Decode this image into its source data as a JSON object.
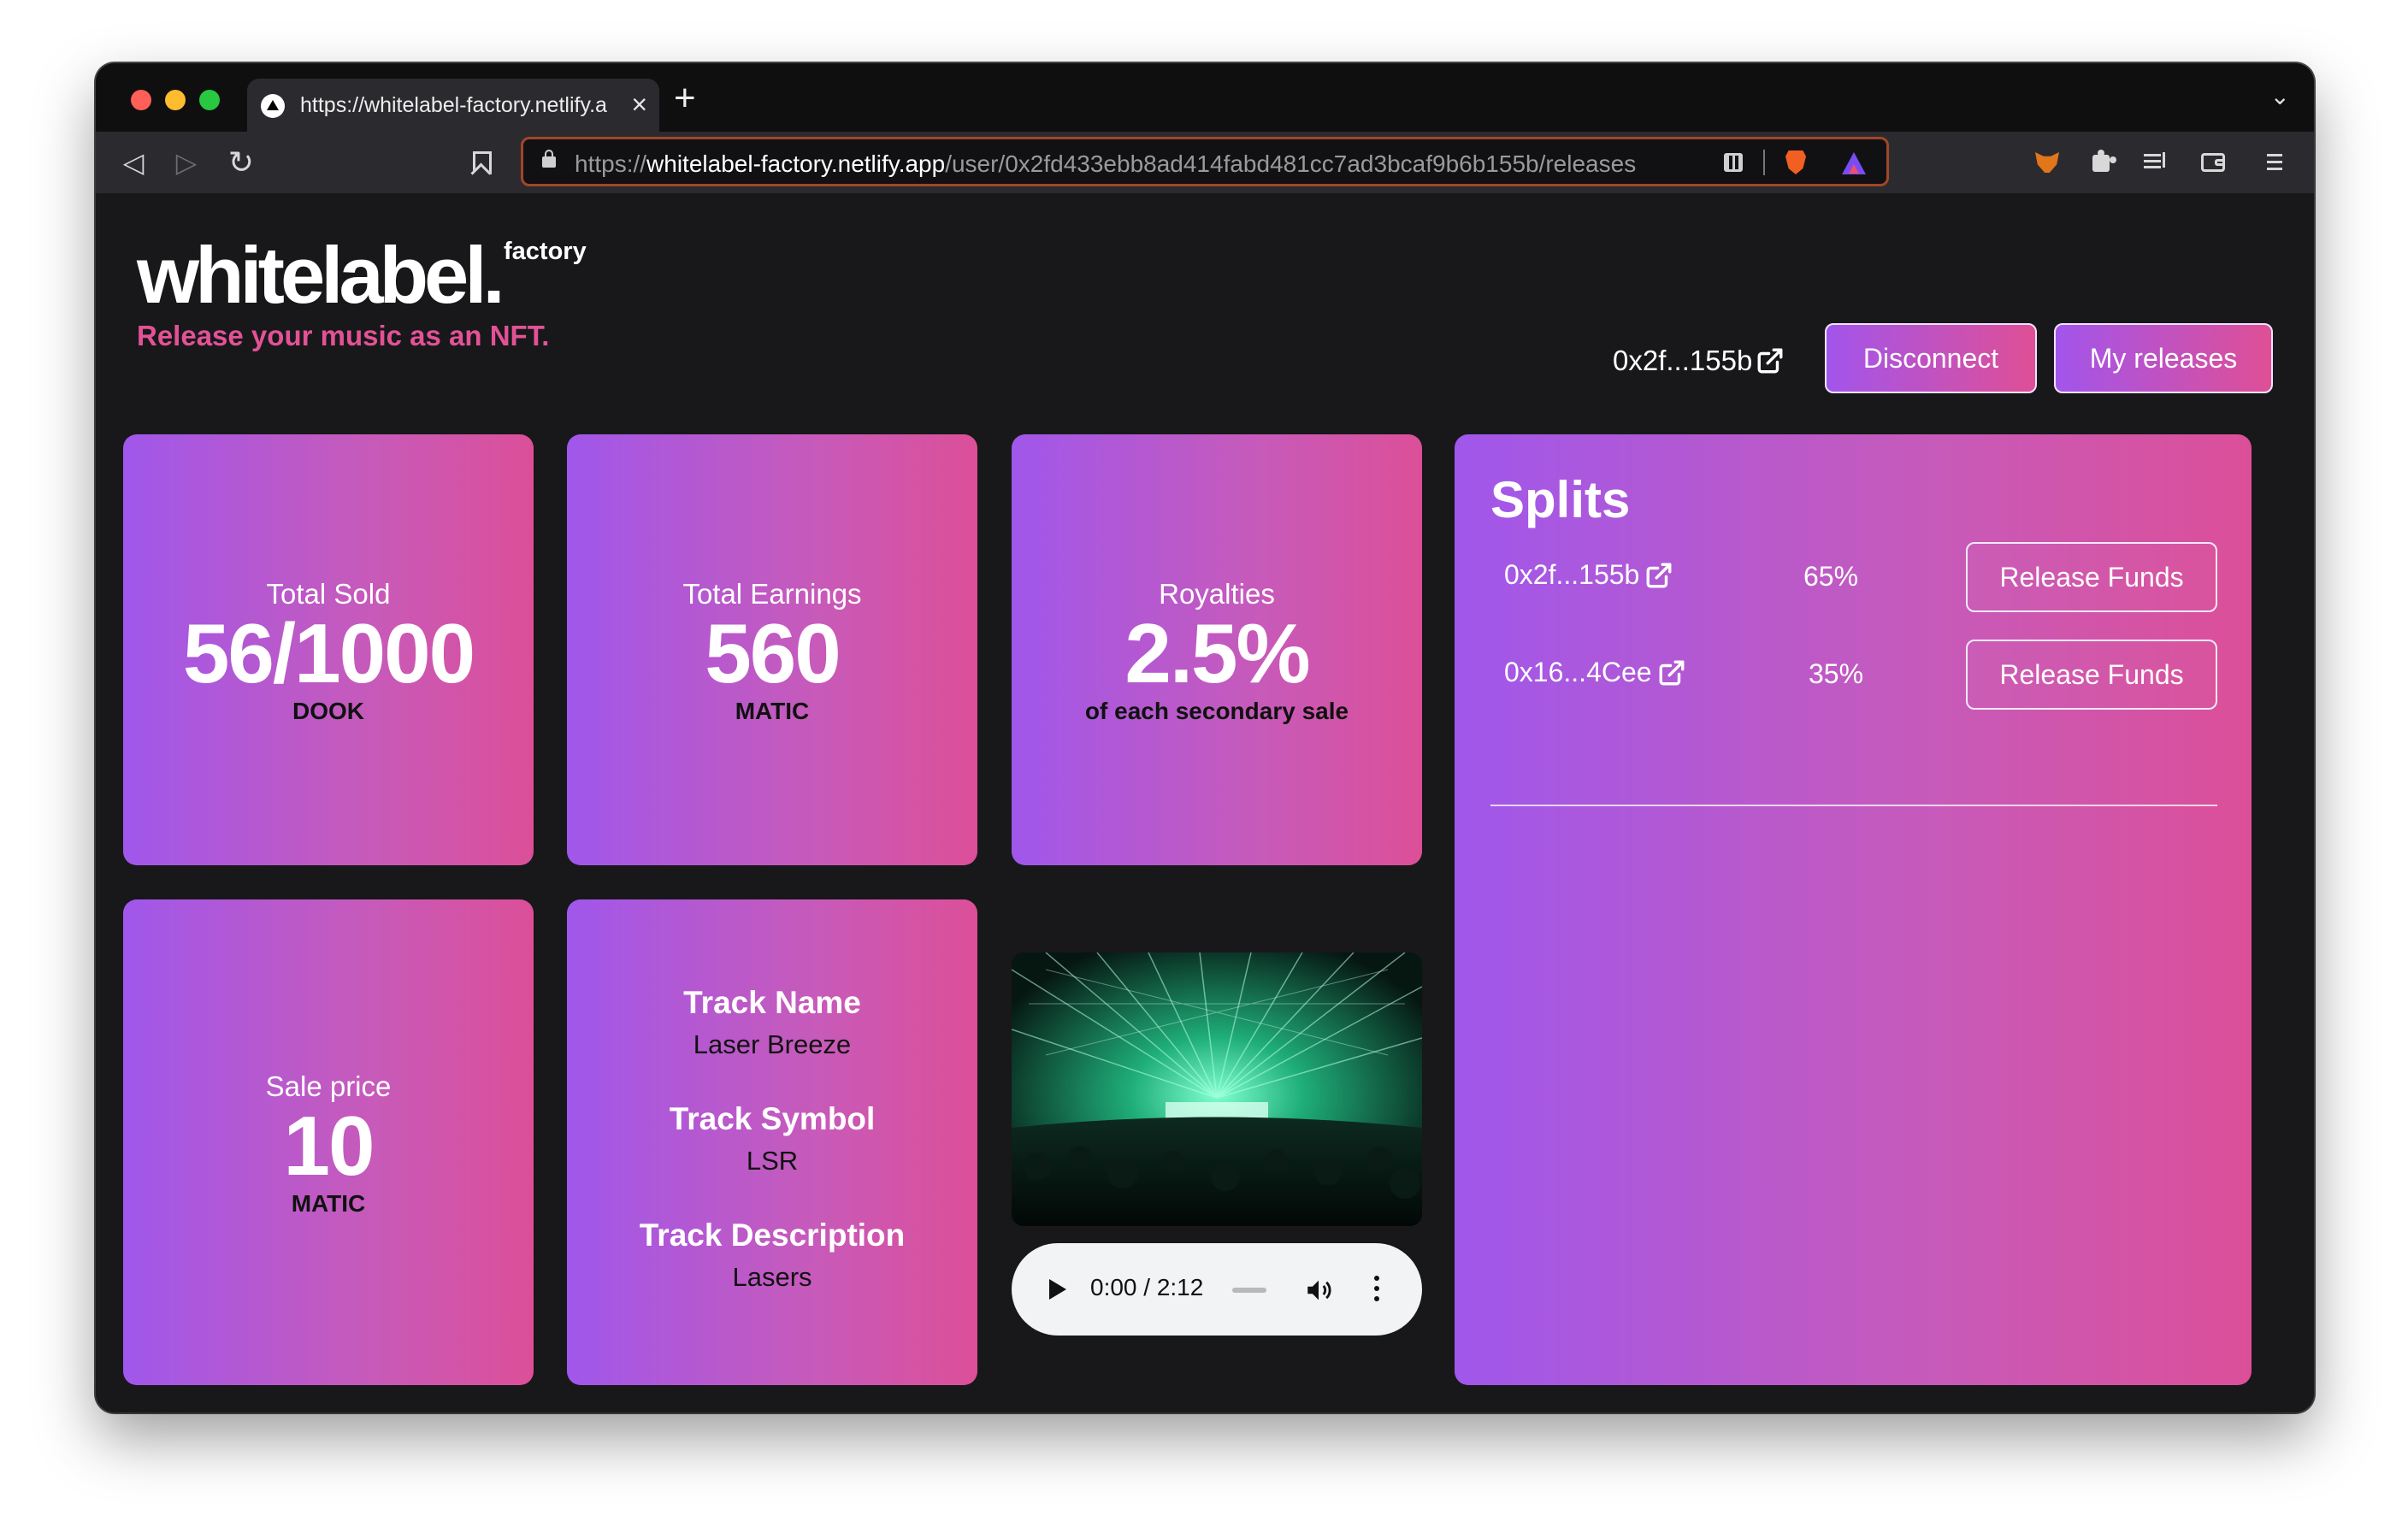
{
  "browser": {
    "tab_title": "https://whitelabel-factory.netlify.app",
    "tab_close": "×",
    "new_tab": "+",
    "tab_menu": "⌄",
    "url_scheme": "https://",
    "url_host": "whitelabel-factory.netlify.app",
    "url_path": "/user/0x2fd433ebb8ad414fabd481cc7ad3bcaf9b6b155b/releases"
  },
  "brand": {
    "logo": "whitelabel.",
    "logo_sub": "factory",
    "tagline": "Release your music as an NFT.",
    "tagline_color": "#e35295"
  },
  "header": {
    "address": "0x2f...155b",
    "disconnect_label": "Disconnect",
    "releases_label": "My releases"
  },
  "stats": {
    "sold": {
      "label": "Total Sold",
      "value": "56/1000",
      "unit": "DOOK"
    },
    "earnings": {
      "label": "Total Earnings",
      "value": "560",
      "unit": "MATIC"
    },
    "royalties": {
      "label": "Royalties",
      "value": "2.5%",
      "unit": "of each secondary sale"
    },
    "price": {
      "label": "Sale price",
      "value": "10",
      "unit": "MATIC"
    }
  },
  "track": {
    "name_label": "Track Name",
    "name": "Laser Breeze",
    "symbol_label": "Track Symbol",
    "symbol": "LSR",
    "description_label": "Track Description",
    "description": "Lasers"
  },
  "player": {
    "time": "0:00 / 2:12"
  },
  "splits": {
    "title": "Splits",
    "rows": [
      {
        "address": "0x2f...155b",
        "percent": "65%",
        "action": "Release Funds"
      },
      {
        "address": "0x16...4Cee",
        "percent": "35%",
        "action": "Release Funds"
      }
    ]
  },
  "colors": {
    "gradient_start": "#a057eb",
    "gradient_end": "#dc4f98",
    "page_bg": "#18181b"
  }
}
